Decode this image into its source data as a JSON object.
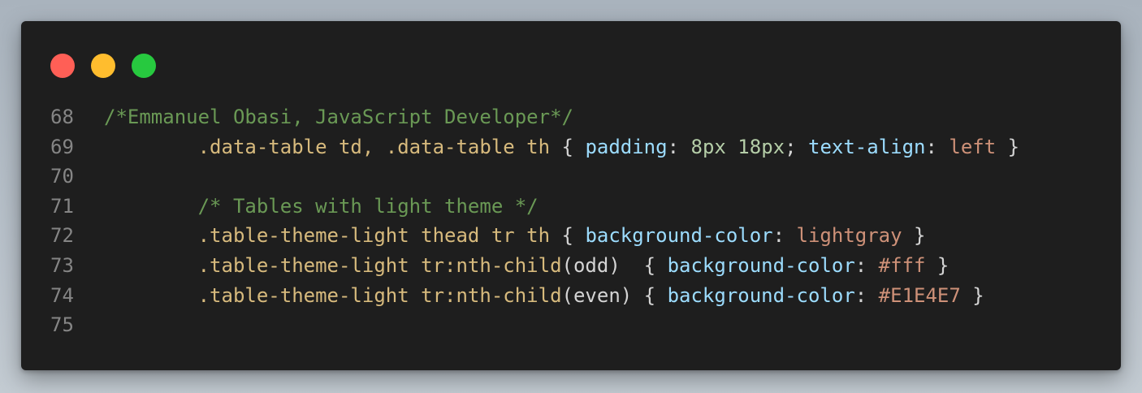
{
  "window": {
    "controls": {
      "close_color": "#ff5f56",
      "minimize_color": "#ffbd2e",
      "maximize_color": "#27c93f"
    }
  },
  "code": {
    "lines": [
      {
        "number": "68",
        "tokens": [
          {
            "t": "/*Emmanuel Obasi, JavaScript Developer*/",
            "k": "comment"
          }
        ]
      },
      {
        "number": "69",
        "tokens": [
          {
            "t": "        ",
            "k": "punc"
          },
          {
            "t": ".data-table td, .data-table th",
            "k": "sel"
          },
          {
            "t": " { ",
            "k": "punc"
          },
          {
            "t": "padding",
            "k": "prop"
          },
          {
            "t": ": ",
            "k": "punc"
          },
          {
            "t": "8px 18px",
            "k": "num"
          },
          {
            "t": "; ",
            "k": "punc"
          },
          {
            "t": "text-align",
            "k": "prop"
          },
          {
            "t": ": ",
            "k": "punc"
          },
          {
            "t": "left",
            "k": "val"
          },
          {
            "t": " }",
            "k": "punc"
          }
        ]
      },
      {
        "number": "70",
        "tokens": []
      },
      {
        "number": "71",
        "tokens": [
          {
            "t": "        ",
            "k": "punc"
          },
          {
            "t": "/* Tables with light theme */",
            "k": "comment"
          }
        ]
      },
      {
        "number": "72",
        "tokens": [
          {
            "t": "        ",
            "k": "punc"
          },
          {
            "t": ".table-theme-light thead tr th",
            "k": "sel"
          },
          {
            "t": " { ",
            "k": "punc"
          },
          {
            "t": "background-color",
            "k": "prop"
          },
          {
            "t": ": ",
            "k": "punc"
          },
          {
            "t": "lightgray",
            "k": "val"
          },
          {
            "t": " }",
            "k": "punc"
          }
        ]
      },
      {
        "number": "73",
        "tokens": [
          {
            "t": "        ",
            "k": "punc"
          },
          {
            "t": ".table-theme-light tr:nth-child",
            "k": "sel"
          },
          {
            "t": "(odd)  { ",
            "k": "punc"
          },
          {
            "t": "background-color",
            "k": "prop"
          },
          {
            "t": ": ",
            "k": "punc"
          },
          {
            "t": "#fff",
            "k": "val"
          },
          {
            "t": " }",
            "k": "punc"
          }
        ]
      },
      {
        "number": "74",
        "tokens": [
          {
            "t": "        ",
            "k": "punc"
          },
          {
            "t": ".table-theme-light tr:nth-child",
            "k": "sel"
          },
          {
            "t": "(even) { ",
            "k": "punc"
          },
          {
            "t": "background-color",
            "k": "prop"
          },
          {
            "t": ": ",
            "k": "punc"
          },
          {
            "t": "#E1E4E7",
            "k": "val"
          },
          {
            "t": " }",
            "k": "punc"
          }
        ]
      },
      {
        "number": "75",
        "tokens": []
      }
    ]
  }
}
